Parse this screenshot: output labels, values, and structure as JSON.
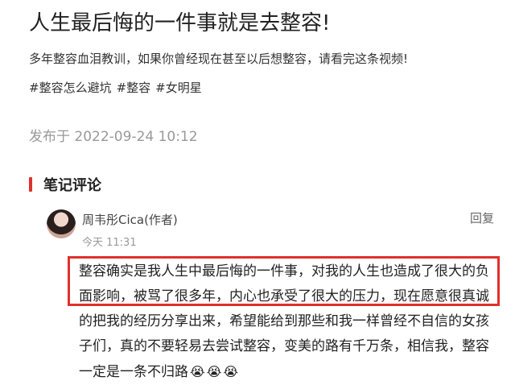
{
  "post": {
    "title": "人生最后悔的一件事就是去整容!",
    "description": "多年整容血泪教训，如果你曾经现在甚至以后想整容，请看完这条视频!",
    "tags": [
      "#整容怎么避坑",
      "#整容",
      "#女明星"
    ],
    "published": "发布于 2022-09-24 10:12"
  },
  "comments_section": {
    "title": "笔记评论",
    "accent_color": "#e0302b"
  },
  "comment": {
    "author": "周韦彤Cica(作者)",
    "time": "今天 11:31",
    "reply_label": "回复",
    "text": "整容确实是我人生中最后悔的一件事，对我的人生也造成了很大的负面影响，被骂了很多年，内心也承受了很大的压力，现在愿意很真诚的把我的经历分享出来，希望能给到那些和我一样曾经不自信的女孩子们，真的不要轻易去尝试整容，变美的路有千万条，相信我，整容一定是一条不归路",
    "emojis": [
      "😭",
      "😭",
      "😭"
    ]
  }
}
